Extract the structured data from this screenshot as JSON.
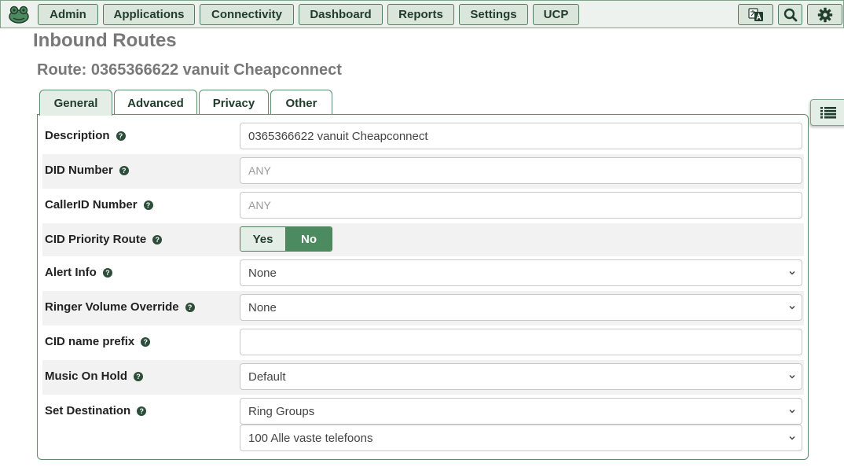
{
  "nav": {
    "items": [
      "Admin",
      "Applications",
      "Connectivity",
      "Dashboard",
      "Reports",
      "Settings",
      "UCP"
    ],
    "icons": [
      "language-icon",
      "search-icon",
      "gear-icon"
    ]
  },
  "page": {
    "title": "Inbound Routes",
    "route_title": "Route: 0365366622 vanuit Cheapconnect"
  },
  "tabs": [
    "General",
    "Advanced",
    "Privacy",
    "Other"
  ],
  "form": {
    "description": {
      "label": "Description",
      "value": "0365366622 vanuit Cheapconnect"
    },
    "did_number": {
      "label": "DID Number",
      "placeholder": "ANY"
    },
    "callerid_number": {
      "label": "CallerID Number",
      "placeholder": "ANY"
    },
    "cid_priority": {
      "label": "CID Priority Route",
      "yes": "Yes",
      "no": "No",
      "selected": "No"
    },
    "alert_info": {
      "label": "Alert Info",
      "value": "None"
    },
    "ringer_volume": {
      "label": "Ringer Volume Override",
      "value": "None"
    },
    "cid_name_prefix": {
      "label": "CID name prefix",
      "value": ""
    },
    "music_on_hold": {
      "label": "Music On Hold",
      "value": "Default"
    },
    "destination": {
      "label": "Set Destination",
      "type": "Ring Groups",
      "target": "100 Alle vaste telefoons"
    }
  },
  "colors": {
    "accent": "#4c8a5f",
    "nav_bg": "#dae5dc",
    "border": "#4f7d5d"
  }
}
